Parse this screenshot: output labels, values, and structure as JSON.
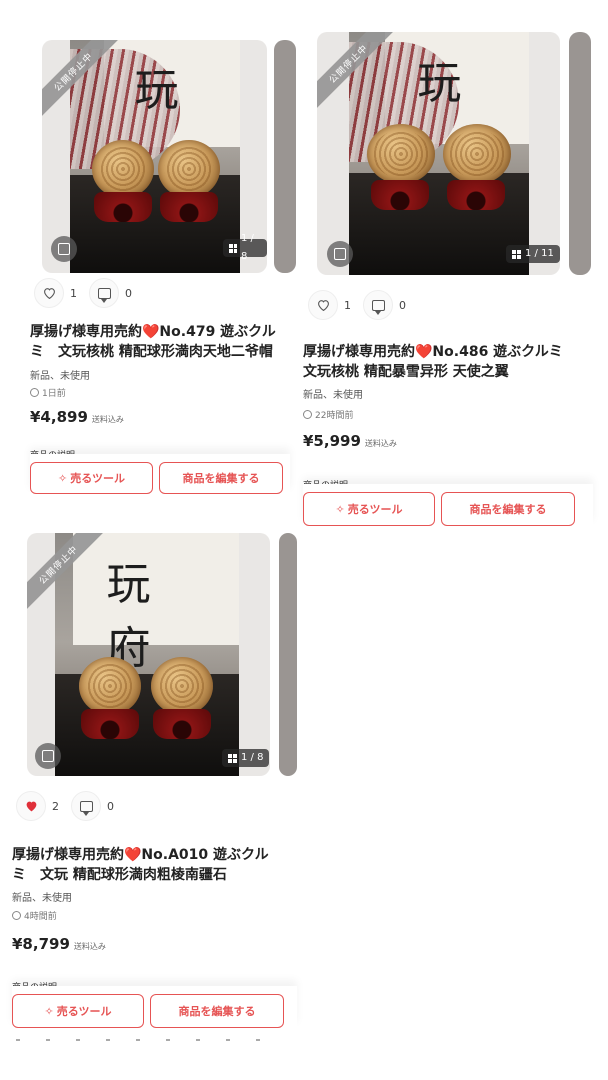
{
  "listings": [
    {
      "status_ribbon": "公開停止中",
      "photo_calligraphy": "玩",
      "image_counter": "1 / 8",
      "likes": "1",
      "comments": "0",
      "liked": false,
      "title": "厚揚げ様専用売約❤️No.479 遊ぶクルミ　文玩核桃 精配球形満肉天地二爷帽",
      "condition": "新品、未使用",
      "time": "1日前",
      "price": "¥4,899",
      "shipping": "送料込み",
      "desc_label": "商品の説明",
      "sell_tool_label": "売るツール",
      "edit_label": "商品を編集する"
    },
    {
      "status_ribbon": "公開停止中",
      "photo_calligraphy": "玩",
      "image_counter": "1 / 11",
      "likes": "1",
      "comments": "0",
      "liked": false,
      "title": "厚揚げ様専用売約❤️No.486 遊ぶクルミ　文玩核桃 精配暴雪异形 天使之翼",
      "condition": "新品、未使用",
      "time": "22時間前",
      "price": "¥5,999",
      "shipping": "送料込み",
      "desc_label": "商品の説明",
      "sell_tool_label": "売るツール",
      "edit_label": "商品を編集する"
    },
    {
      "status_ribbon": "公開停止中",
      "photo_calligraphy": "玩 府",
      "image_counter": "1 / 8",
      "likes": "2",
      "comments": "0",
      "liked": true,
      "title": "厚揚げ様専用売約❤️No.A010 遊ぶクルミ　文玩 精配球形満肉粗棱南疆石",
      "condition": "新品、未使用",
      "time": "4時間前",
      "price": "¥8,799",
      "shipping": "送料込み",
      "desc_label": "商品の説明",
      "sell_tool_label": "売るツール",
      "edit_label": "商品を編集する"
    }
  ],
  "colors": {
    "accent": "#e65454",
    "heart_liked": "#e0303a"
  }
}
